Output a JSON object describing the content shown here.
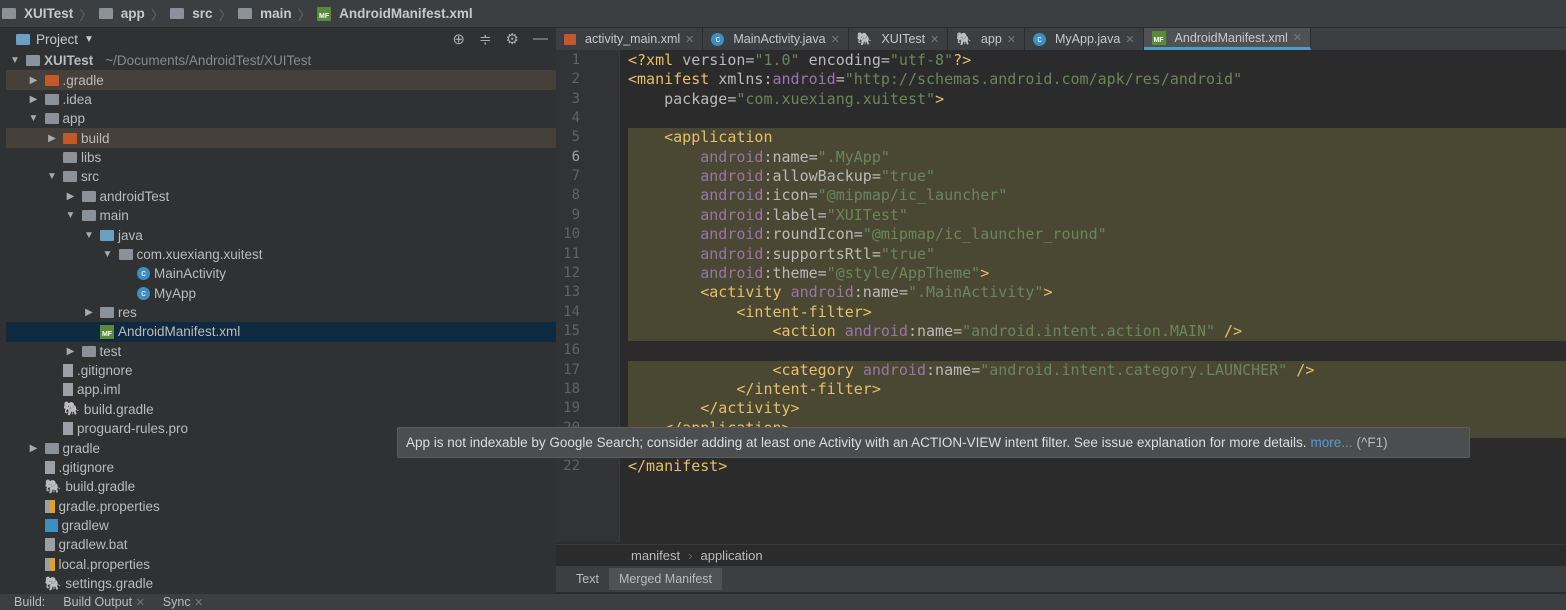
{
  "breadcrumb": [
    "XUITest",
    "app",
    "src",
    "main",
    "AndroidManifest.xml"
  ],
  "project_panel": {
    "title": "Project",
    "icons": [
      "locate-icon",
      "collapse-icon",
      "gear-icon",
      "minimize-icon"
    ]
  },
  "tree": [
    {
      "d": 0,
      "arrow": "down",
      "icon": "project-folder",
      "label": "XUITest",
      "path": "~/Documents/AndroidTest/XUITest"
    },
    {
      "d": 1,
      "arrow": "right",
      "icon": "folder-orange",
      "label": ".gradle",
      "hl": "brown"
    },
    {
      "d": 1,
      "arrow": "right",
      "icon": "folder",
      "label": ".idea"
    },
    {
      "d": 1,
      "arrow": "down",
      "icon": "module-folder",
      "label": "app"
    },
    {
      "d": 2,
      "arrow": "right",
      "icon": "folder-orange",
      "label": "build",
      "hl": "brown"
    },
    {
      "d": 2,
      "arrow": "",
      "icon": "folder",
      "label": "libs"
    },
    {
      "d": 2,
      "arrow": "down",
      "icon": "folder",
      "label": "src"
    },
    {
      "d": 3,
      "arrow": "right",
      "icon": "folder",
      "label": "androidTest"
    },
    {
      "d": 3,
      "arrow": "down",
      "icon": "folder",
      "label": "main"
    },
    {
      "d": 4,
      "arrow": "down",
      "icon": "folder-blue",
      "label": "java"
    },
    {
      "d": 5,
      "arrow": "down",
      "icon": "package",
      "label": "com.xuexiang.xuitest"
    },
    {
      "d": 6,
      "arrow": "",
      "icon": "class",
      "label": "MainActivity"
    },
    {
      "d": 6,
      "arrow": "",
      "icon": "class",
      "label": "MyApp"
    },
    {
      "d": 4,
      "arrow": "right",
      "icon": "folder",
      "label": "res"
    },
    {
      "d": 4,
      "arrow": "",
      "icon": "manifest",
      "label": "AndroidManifest.xml",
      "hl": "sel"
    },
    {
      "d": 3,
      "arrow": "right",
      "icon": "folder",
      "label": "test"
    },
    {
      "d": 2,
      "arrow": "",
      "icon": "file",
      "label": ".gitignore"
    },
    {
      "d": 2,
      "arrow": "",
      "icon": "file",
      "label": "app.iml"
    },
    {
      "d": 2,
      "arrow": "",
      "icon": "gradle",
      "label": "build.gradle"
    },
    {
      "d": 2,
      "arrow": "",
      "icon": "file",
      "label": "proguard-rules.pro"
    },
    {
      "d": 1,
      "arrow": "right",
      "icon": "folder",
      "label": "gradle"
    },
    {
      "d": 1,
      "arrow": "",
      "icon": "file",
      "label": ".gitignore"
    },
    {
      "d": 1,
      "arrow": "",
      "icon": "gradle",
      "label": "build.gradle"
    },
    {
      "d": 1,
      "arrow": "",
      "icon": "properties",
      "label": "gradle.properties"
    },
    {
      "d": 1,
      "arrow": "",
      "icon": "terminal",
      "label": "gradlew"
    },
    {
      "d": 1,
      "arrow": "",
      "icon": "file",
      "label": "gradlew.bat"
    },
    {
      "d": 1,
      "arrow": "",
      "icon": "properties",
      "label": "local.properties"
    },
    {
      "d": 1,
      "arrow": "",
      "icon": "gradle",
      "label": "settings.gradle"
    }
  ],
  "tabs": [
    {
      "label": "activity_main.xml",
      "icon": "xml"
    },
    {
      "label": "MainActivity.java",
      "icon": "class"
    },
    {
      "label": "XUITest",
      "icon": "gradle"
    },
    {
      "label": "app",
      "icon": "gradle"
    },
    {
      "label": "MyApp.java",
      "icon": "class"
    },
    {
      "label": "AndroidManifest.xml",
      "icon": "manifest",
      "active": true
    }
  ],
  "code": [
    [
      [
        "tag",
        "<?xml "
      ],
      [
        "attr",
        "version"
      ],
      [
        "plain",
        "="
      ],
      [
        "str",
        "\"1.0\""
      ],
      [
        "attr",
        " encoding"
      ],
      [
        "plain",
        "="
      ],
      [
        "str",
        "\"utf-8\""
      ],
      [
        "tag",
        "?>"
      ]
    ],
    [
      [
        "tag",
        "<manifest "
      ],
      [
        "attr",
        "xmlns:"
      ],
      [
        "ns",
        "android"
      ],
      [
        "plain",
        "="
      ],
      [
        "str",
        "\"http://schemas.android.com/apk/res/android\""
      ]
    ],
    [
      [
        "attr",
        "    package"
      ],
      [
        "plain",
        "="
      ],
      [
        "str",
        "\"com.xuexiang.xuitest\""
      ],
      [
        "tag",
        ">"
      ]
    ],
    [],
    [
      [
        "tag",
        "    <application"
      ]
    ],
    [
      [
        "ns",
        "        android"
      ],
      [
        "attr",
        ":name"
      ],
      [
        "plain",
        "="
      ],
      [
        "str",
        "\".MyApp\""
      ]
    ],
    [
      [
        "ns",
        "        android"
      ],
      [
        "attr",
        ":allowBackup"
      ],
      [
        "plain",
        "="
      ],
      [
        "str",
        "\"true\""
      ]
    ],
    [
      [
        "ns",
        "        android"
      ],
      [
        "attr",
        ":icon"
      ],
      [
        "plain",
        "="
      ],
      [
        "str",
        "\"@mipmap/ic_launcher\""
      ]
    ],
    [
      [
        "ns",
        "        android"
      ],
      [
        "attr",
        ":label"
      ],
      [
        "plain",
        "="
      ],
      [
        "str",
        "\"XUITest\""
      ]
    ],
    [
      [
        "ns",
        "        android"
      ],
      [
        "attr",
        ":roundIcon"
      ],
      [
        "plain",
        "="
      ],
      [
        "str",
        "\"@mipmap/ic_launcher_round\""
      ]
    ],
    [
      [
        "ns",
        "        android"
      ],
      [
        "attr",
        ":supportsRtl"
      ],
      [
        "plain",
        "="
      ],
      [
        "str",
        "\"true\""
      ]
    ],
    [
      [
        "ns",
        "        android"
      ],
      [
        "attr",
        ":theme"
      ],
      [
        "plain",
        "="
      ],
      [
        "str",
        "\"@style/AppTheme\""
      ],
      [
        "tag",
        ">"
      ]
    ],
    [
      [
        "tag",
        "        <activity "
      ],
      [
        "ns",
        "android"
      ],
      [
        "attr",
        ":name"
      ],
      [
        "plain",
        "="
      ],
      [
        "str",
        "\".MainActivity\""
      ],
      [
        "tag",
        ">"
      ]
    ],
    [
      [
        "tag",
        "            <intent-filter>"
      ]
    ],
    [
      [
        "tag",
        "                <action "
      ],
      [
        "ns",
        "android"
      ],
      [
        "attr",
        ":name"
      ],
      [
        "plain",
        "="
      ],
      [
        "str",
        "\"android.intent.action.MAIN\""
      ],
      [
        "tag",
        " />"
      ]
    ],
    [],
    [
      [
        "tag",
        "                <category "
      ],
      [
        "ns",
        "android"
      ],
      [
        "attr",
        ":name"
      ],
      [
        "plain",
        "="
      ],
      [
        "str",
        "\"android.intent.category.LAUNCHER\""
      ],
      [
        "tag",
        " />"
      ]
    ],
    [
      [
        "tag",
        "            </intent-filter>"
      ]
    ],
    [
      [
        "tag",
        "        </activity>"
      ]
    ],
    [
      [
        "tag",
        "    </application>"
      ]
    ],
    [],
    [
      [
        "tag",
        "</manifest>"
      ]
    ]
  ],
  "highlighted_lines": [
    5,
    20
  ],
  "tooltip": {
    "text": "App is not indexable by Google Search; consider adding at least one Activity with an ACTION-VIEW intent filter. See issue explanation for more details.",
    "link": "more...",
    "shortcut": "(^F1)"
  },
  "editor_breadcrumb": [
    "manifest",
    "application"
  ],
  "bottom_tabs": [
    "Text",
    "Merged Manifest"
  ],
  "status": {
    "label": "Build:",
    "tabs": [
      "Build Output",
      "Sync"
    ]
  }
}
